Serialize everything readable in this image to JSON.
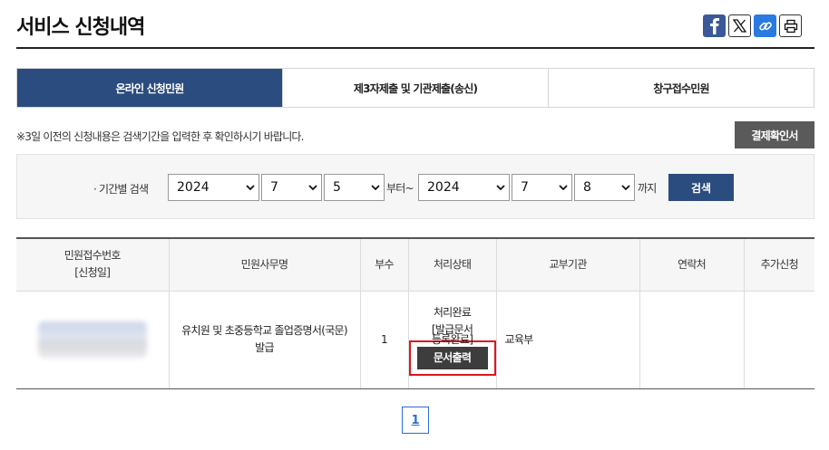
{
  "page": {
    "title": "서비스 신청내역"
  },
  "share": [
    {
      "name": "facebook-icon"
    },
    {
      "name": "x-icon"
    },
    {
      "name": "link-icon"
    },
    {
      "name": "print-icon"
    }
  ],
  "tabs": [
    {
      "label": "온라인 신청민원",
      "active": true
    },
    {
      "label": "제3자제출 및 기관제출(송신)",
      "active": false
    },
    {
      "label": "창구접수민원",
      "active": false
    }
  ],
  "notice": "※3일 이전의 신청내용은 검색기간을 입력한 후 확인하시기 바랍니다.",
  "pay_button": "결제확인서",
  "search": {
    "label": "· 기간별 검색",
    "from_year": "2024",
    "from_month": "7",
    "from_day": "5",
    "from_word": "부터~",
    "to_year": "2024",
    "to_month": "7",
    "to_day": "8",
    "to_word": "까지",
    "button": "검색"
  },
  "table": {
    "headers": [
      "민원접수번호",
      "[신청일]",
      "민원사무명",
      "부수",
      "처리상태",
      "교부기관",
      "연락처",
      "추가신청"
    ],
    "row": {
      "service": "유치원 및 초중등학교 졸업증명서(국문) 발급",
      "copies": "1",
      "status_line1": "처리완료",
      "status_line2": "[발급문서",
      "status_line3": "등록완료]",
      "print_button": "문서출력",
      "agency": "교육부",
      "contact": "",
      "extra": ""
    }
  },
  "pagination": {
    "current": "1"
  },
  "colors": {
    "primary": "#2b4c7e",
    "highlight": "#e0141e",
    "dark_button": "#3d3d3d"
  }
}
